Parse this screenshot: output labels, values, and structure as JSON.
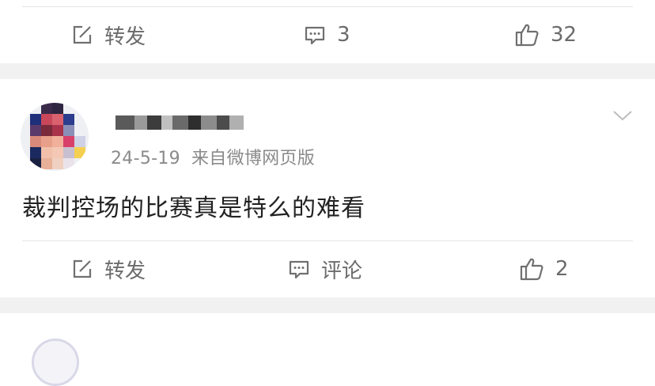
{
  "top_post_actions": {
    "repost_label": "转发",
    "comment_label": "3",
    "like_label": "32"
  },
  "post": {
    "date": "24-5-19",
    "source": "来自微博网页版",
    "content": "裁判控场的比赛真是特么的难看",
    "actions": {
      "repost_label": "转发",
      "comment_label": "评论",
      "like_label": "2"
    }
  },
  "colors": {
    "background": "#ffffff",
    "separator": "#f1f1f1",
    "text": "#222222",
    "meta_text": "#8a8a8a",
    "action_text": "#6b6b6b"
  },
  "icons": [
    "compose-icon",
    "comment-icon",
    "thumbs-up-icon",
    "chevron-down-icon"
  ]
}
